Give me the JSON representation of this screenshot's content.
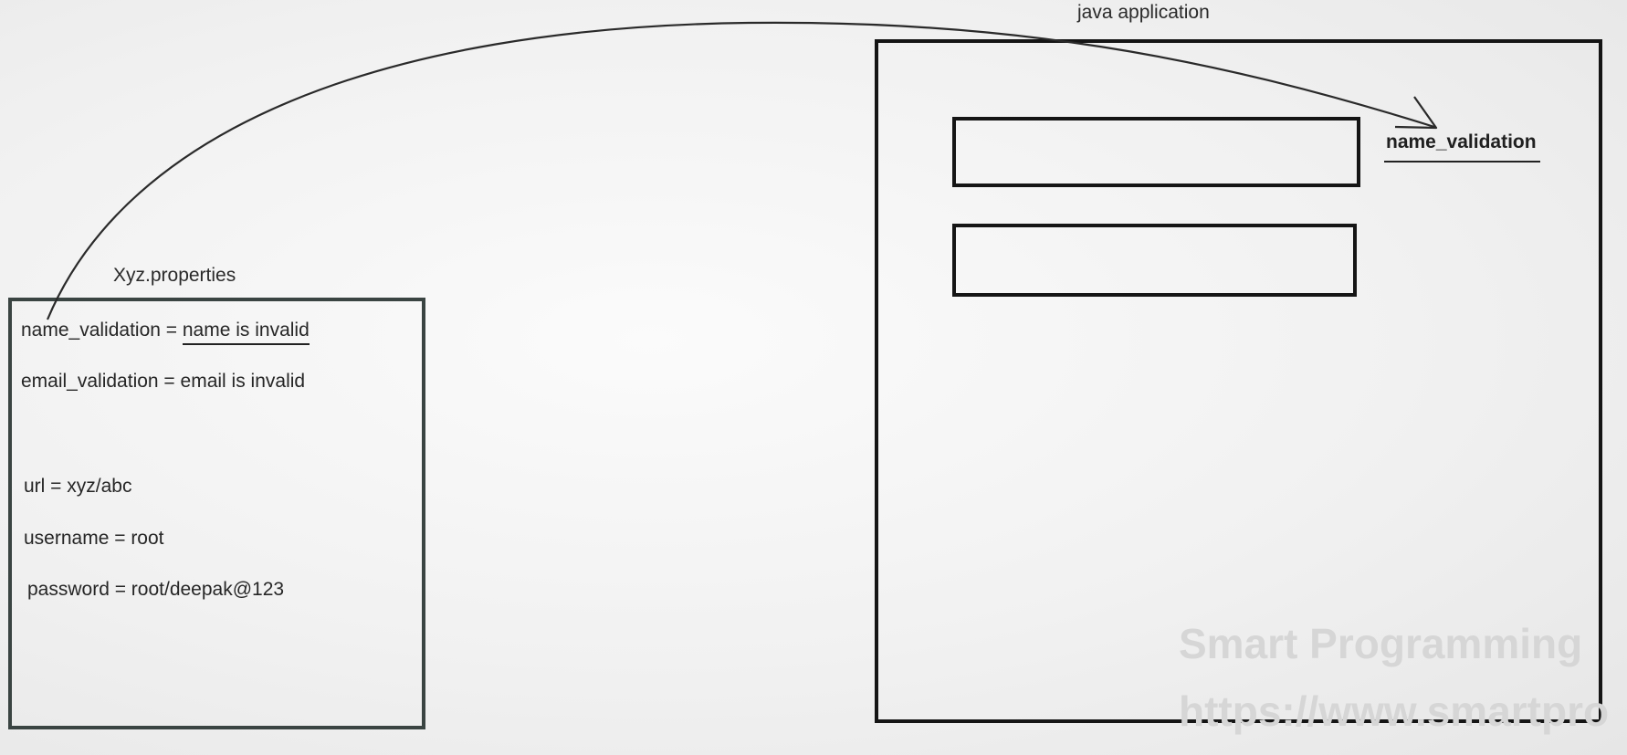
{
  "diagram": {
    "properties_file": {
      "title": "Xyz.properties",
      "lines": [
        {
          "key": "name_validation = ",
          "value": "name is invalid"
        },
        {
          "text": "email_validation = email is invalid"
        },
        {
          "text": "url = xyz/abc"
        },
        {
          "text": "username = root"
        },
        {
          "text": "password = root/deepak@123"
        }
      ]
    },
    "java_app": {
      "title": "java application",
      "key_label": "name_validation"
    },
    "watermark": {
      "line1": "Smart Programming",
      "line2": "https://www.smartpro"
    }
  }
}
